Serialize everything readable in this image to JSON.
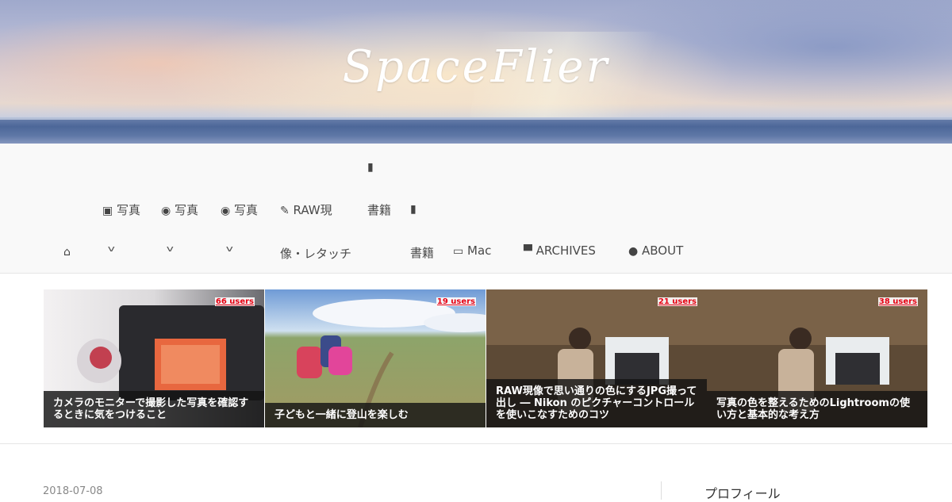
{
  "site": {
    "title": "SpaceFlier"
  },
  "nav": {
    "home_icon": "home-icon",
    "items": [
      {
        "icon": "image-icon",
        "glyph": "▣",
        "label": "写真"
      },
      {
        "icon": "camera-icon",
        "glyph": "◉",
        "label": "写真"
      },
      {
        "icon": "camera-icon",
        "glyph": "◉",
        "label": "写真"
      },
      {
        "icon": "edit-icon",
        "glyph": "✎",
        "label": "RAW現",
        "label2": "像・レタッチ"
      },
      {
        "icon": "book-icon",
        "glyph": "▮",
        "label": "書籍"
      },
      {
        "icon": "book-icon",
        "glyph": "▮",
        "label": "書籍"
      },
      {
        "icon": "laptop-icon",
        "glyph": "▭",
        "label": "Mac"
      },
      {
        "icon": "archive-icon",
        "glyph": "▀",
        "label": "ARCHIVES"
      },
      {
        "icon": "user-icon",
        "glyph": "●",
        "label": "ABOUT"
      }
    ]
  },
  "featured": [
    {
      "users": "66 users",
      "title": "カメラのモニターで撮影した写真を確認するときに気をつけること"
    },
    {
      "users": "19 users",
      "title": "子どもと一緒に登山を楽しむ"
    },
    {
      "users": "21 users",
      "title": "RAW現像で思い通りの色にするJPG撮って出し ― Nikon のピクチャーコントロールを使いこなすためのコツ"
    },
    {
      "users": "38 users",
      "title": "写真の色を整えるためのLightroomの使い方と基本的な考え方"
    }
  ],
  "post": {
    "date": "2018-07-08"
  },
  "sidebar": {
    "title": "プロフィール"
  },
  "colors": {
    "caption_bg": "#141414",
    "users_badge": "#e60012",
    "nav_bg": "#f9f9f9"
  }
}
